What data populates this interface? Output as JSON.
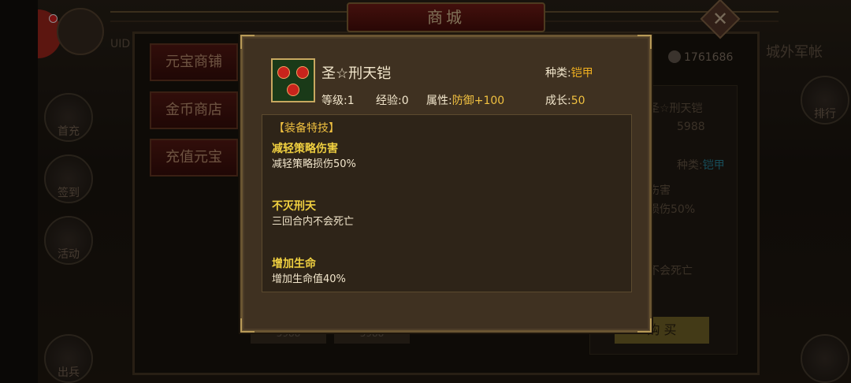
{
  "shop": {
    "title": "商城",
    "uid_label": "UID",
    "currency_amount": "1761686",
    "city_button": "城外军帐",
    "tabs": [
      "元宝商铺",
      "金币商店",
      "充值元宝"
    ],
    "left_menu": [
      "首充",
      "签到",
      "活动",
      "出兵"
    ],
    "right_menu": [
      "排行"
    ],
    "close_symbol": "✕",
    "buy_label": "购 买",
    "price_tags": [
      "5988",
      "5988"
    ],
    "bg_card": {
      "name": "圣☆刑天铠",
      "price": "5988",
      "kind_label": "种类:",
      "kind_value": "铠甲",
      "text_fragment_1": "伤害",
      "text_fragment_2": "损伤50%",
      "text_fragment_3": "不会死亡"
    }
  },
  "popup": {
    "item_name": "圣☆刑天铠",
    "kind_label": "种类:",
    "kind_value": "铠甲",
    "level_label": "等级:",
    "level_value": "1",
    "exp_label": "经验:",
    "exp_value": "0",
    "attr_label": "属性:",
    "attr_value": "防御+100",
    "growth_label": "成长:",
    "growth_value": "50",
    "skills_header": "【装备特技】",
    "skills": [
      {
        "title": "减轻策略伤害",
        "desc": "减轻策略损伤50%"
      },
      {
        "title": "不灭刑天",
        "desc": "三回合内不会死亡"
      },
      {
        "title": "增加生命",
        "desc": "增加生命值40%"
      }
    ]
  },
  "colors": {
    "highlight_value": "#f0c040",
    "kind_value": "#f0b020",
    "skill_title": "#f0d040"
  },
  "icons": [
    "close-icon",
    "coin-icon",
    "item-armor-icon",
    "avatar-portrait",
    "notification-dot"
  ]
}
